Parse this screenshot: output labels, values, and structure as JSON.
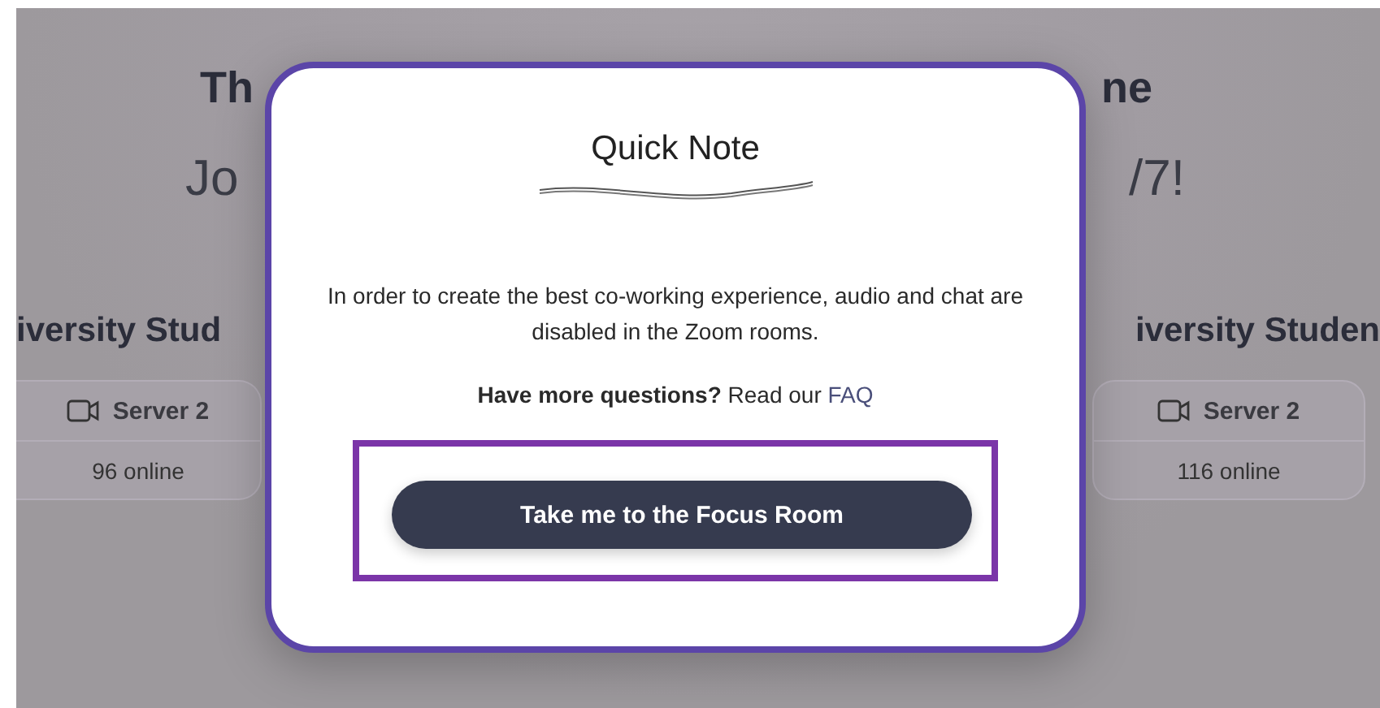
{
  "background": {
    "heading_fragments": [
      "Th",
      "ne"
    ],
    "subheading_fragments": [
      "Jo",
      "/7!"
    ],
    "group_fragments": [
      "iversity Stud",
      "iversity Studen"
    ],
    "servers": [
      {
        "name": "Server 2",
        "online": "96 online"
      },
      {
        "name": "Server 2",
        "online": "116 online"
      }
    ]
  },
  "dialog": {
    "title": "Quick Note",
    "message": "In order to create the best co-working experience, audio and chat are disabled in the Zoom rooms.",
    "question": "**Have more questions?** Read our",
    "link": "FAQ",
    "button": {
      "label": "Take me to the Focus Room",
      "highlighted": true
    }
  }
}
